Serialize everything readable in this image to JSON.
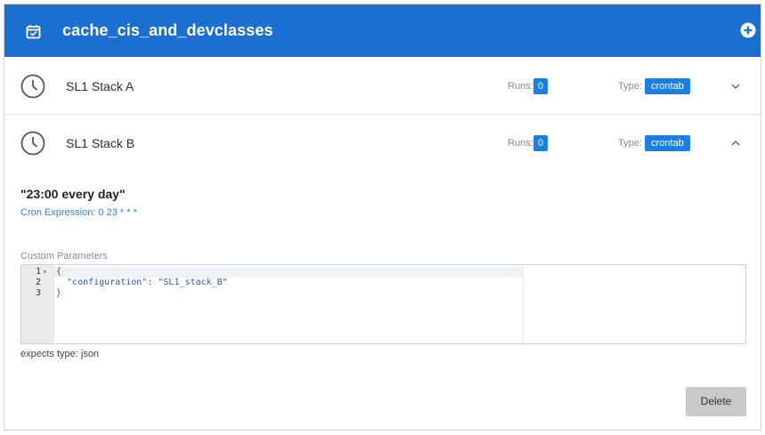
{
  "header": {
    "title": "cache_cis_and_devclasses",
    "icon": "calendar-check-icon",
    "add_icon": "plus-circle-icon",
    "bg_color": "#1a6fd1"
  },
  "schedules": [
    {
      "name": "SL1 Stack A",
      "runs_label": "Runs:",
      "runs": "0",
      "type_label": "Type:",
      "type": "crontab",
      "expanded": false
    },
    {
      "name": "SL1 Stack B",
      "runs_label": "Runs:",
      "runs": "0",
      "type_label": "Type:",
      "type": "crontab",
      "expanded": true
    }
  ],
  "detail": {
    "schedule_text": "\"23:00 every day\"",
    "cron_expression": "Cron Expression: 0 23 * * *",
    "custom_params_label": "Custom Parameters",
    "editor_lines": [
      {
        "num": "1",
        "fold": "▾",
        "text": "{"
      },
      {
        "num": "2",
        "fold": "",
        "text": "  \"configuration\": \"SL1_stack_B\""
      },
      {
        "num": "3",
        "fold": "",
        "text": "}"
      }
    ],
    "expects_type": "expects type: json",
    "delete_label": "Delete"
  }
}
